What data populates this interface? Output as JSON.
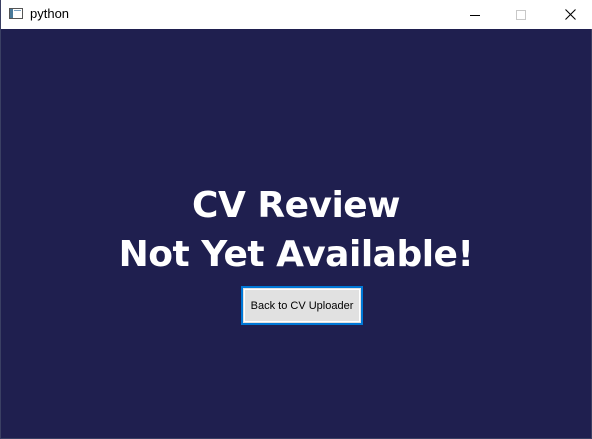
{
  "window": {
    "title": "python",
    "controls": {
      "minimize_icon": "minimize-icon",
      "maximize_icon": "maximize-icon",
      "close_icon": "close-icon"
    }
  },
  "main": {
    "heading_line1": "CV Review",
    "heading_line2": "Not Yet Available!",
    "back_button_label": "Back to CV Uploader"
  },
  "colors": {
    "background": "#1f1f4f",
    "heading_text": "#ffffff",
    "button_bg": "#e1e1e1",
    "button_focus_border": "#0078d7"
  }
}
